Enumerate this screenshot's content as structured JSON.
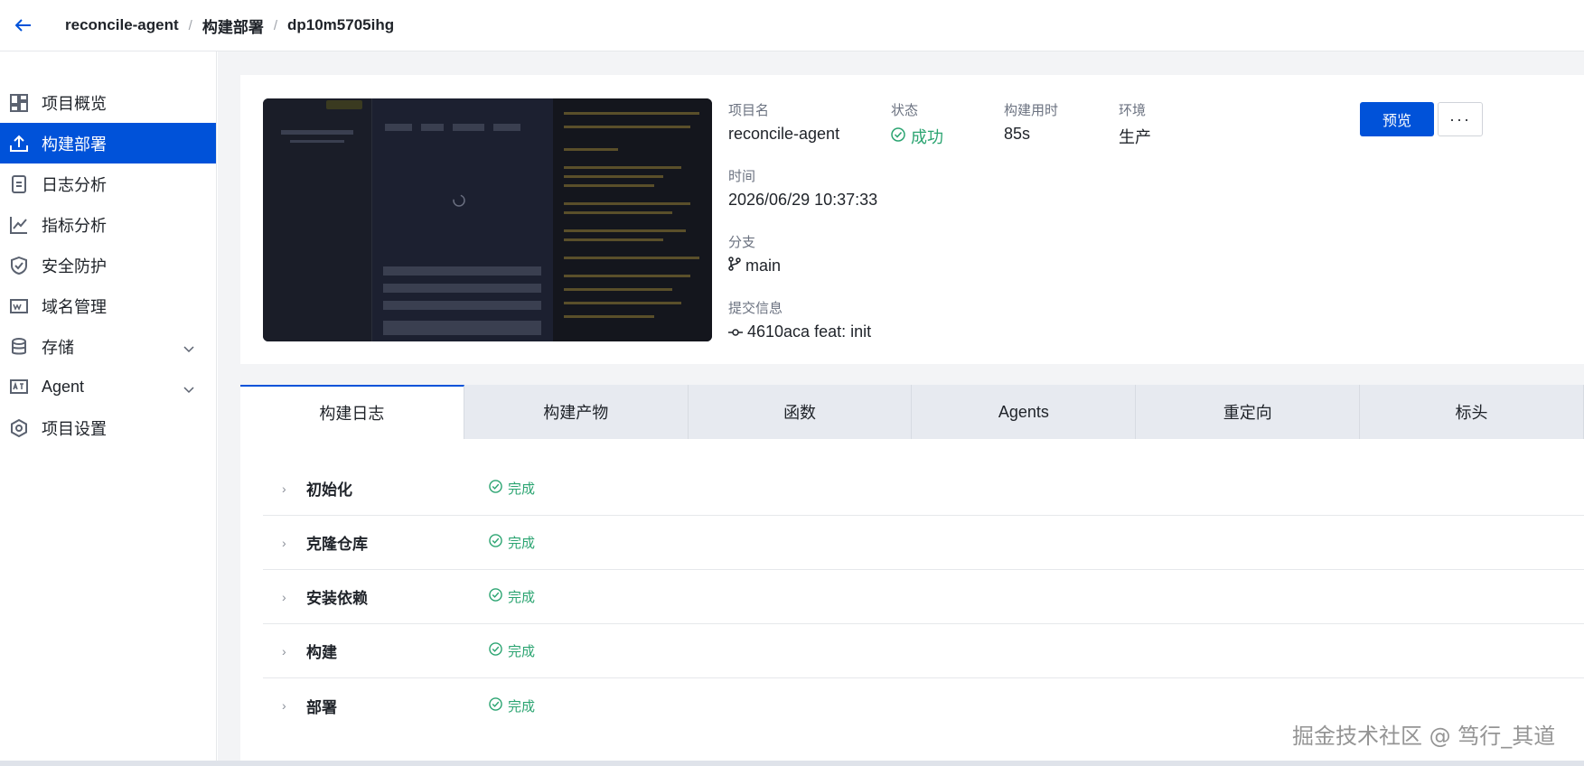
{
  "header": {
    "breadcrumb": [
      "reconcile-agent",
      "构建部署",
      "dp10m5705ihg"
    ]
  },
  "sidebar": {
    "items": [
      {
        "label": "项目概览",
        "icon": "dashboard-icon"
      },
      {
        "label": "构建部署",
        "icon": "upload-icon",
        "active": true
      },
      {
        "label": "日志分析",
        "icon": "document-icon"
      },
      {
        "label": "指标分析",
        "icon": "line-chart-icon"
      },
      {
        "label": "安全防护",
        "icon": "shield-icon"
      },
      {
        "label": "域名管理",
        "icon": "www-icon"
      },
      {
        "label": "存储",
        "icon": "database-icon",
        "expandable": true
      },
      {
        "label": "Agent",
        "icon": "ai-icon",
        "expandable": true
      },
      {
        "label": "项目设置",
        "icon": "settings-icon"
      }
    ]
  },
  "deployment": {
    "project_label": "项目名",
    "project_value": "reconcile-agent",
    "status_label": "状态",
    "status_value": "成功",
    "duration_label": "构建用时",
    "duration_value": "85s",
    "env_label": "环境",
    "env_value": "生产",
    "time_label": "时间",
    "time_value": "2026/06/29 10:37:33",
    "branch_label": "分支",
    "branch_value": "main",
    "commit_label": "提交信息",
    "commit_value": "4610aca feat: init",
    "preview_button": "预览",
    "more_button": "···"
  },
  "tabs": [
    "构建日志",
    "构建产物",
    "函数",
    "Agents",
    "重定向",
    "标头"
  ],
  "steps": [
    {
      "name": "初始化",
      "status": "完成"
    },
    {
      "name": "克隆仓库",
      "status": "完成"
    },
    {
      "name": "安装依赖",
      "status": "完成"
    },
    {
      "name": "构建",
      "status": "完成"
    },
    {
      "name": "部署",
      "status": "完成"
    }
  ],
  "watermark": "掘金技术社区 @ 笃行_其道",
  "colors": {
    "primary": "#0052d9",
    "success": "#2ba471",
    "background": "#f3f4f6"
  }
}
